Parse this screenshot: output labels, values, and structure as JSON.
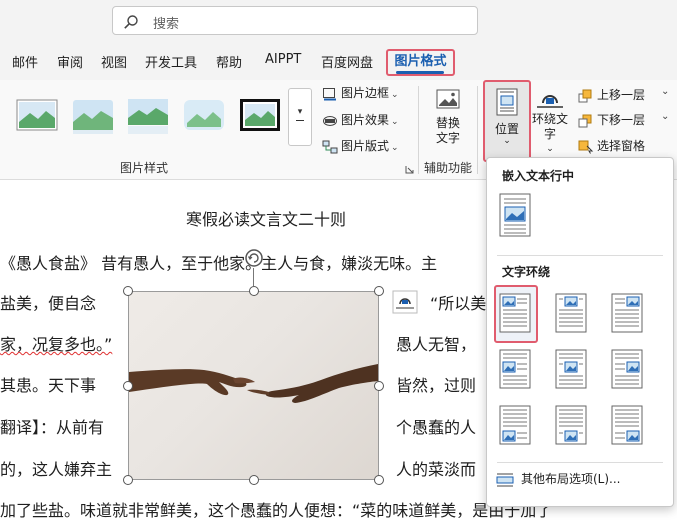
{
  "search": {
    "placeholder": "搜索"
  },
  "tabs": [
    {
      "label": "邮件"
    },
    {
      "label": "审阅"
    },
    {
      "label": "视图"
    },
    {
      "label": "开发工具"
    },
    {
      "label": "帮助"
    },
    {
      "label": "AIPPT"
    },
    {
      "label": "百度网盘"
    }
  ],
  "active_tab": {
    "label": "图片格式"
  },
  "ribbon": {
    "picture_styles_label": "图片样式",
    "border": "图片边框",
    "effects": "图片效果",
    "layout": "图片版式",
    "alt_text": "替换文字",
    "accessibility_label": "辅助功能",
    "position": "位置",
    "wrap_text": "环绕文字",
    "bring_forward": "上移一层",
    "send_backward": "下移一层",
    "selection_pane": "选择窗格"
  },
  "document": {
    "title": "寒假必读文言文二十则",
    "lines": [
      "《愚人食盐》 昔有愚人，至于他家。主人与食，嫌淡无味。主",
      "盐美，便自念",
      "家，况复多也。”",
      "其患。天下事",
      "翻译】：从前有",
      "的，这人嫌弃主",
      "加了些盐。味道就非常鲜美，这个愚蠢的人便想：“菜的味道鲜美，是由于加了"
    ],
    "right_lines": [
      "“所以美",
      "愚人无智，",
      "皆然，过则",
      "个愚蠢的人",
      "人的菜淡而"
    ]
  },
  "position_menu": {
    "inline_heading": "嵌入文本行中",
    "wrap_heading": "文字环绕",
    "more_options": "其他布局选项(L)..."
  },
  "colors": {
    "accent": "#1b5fb0",
    "highlight_border": "#e05c6e",
    "ribbon_bg": "#f9f9f9",
    "topbar_bg": "#f3f3f3"
  }
}
